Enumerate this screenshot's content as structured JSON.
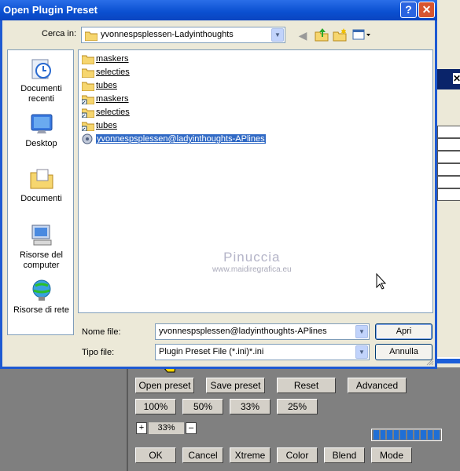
{
  "dialog": {
    "title": "Open Plugin Preset",
    "lookin_label": "Cerca in:",
    "lookin_value": "yvonnespsplessen-Ladyinthoughts",
    "places": [
      {
        "label": "Documenti recenti",
        "icon": "recent-documents-icon"
      },
      {
        "label": "Desktop",
        "icon": "desktop-icon"
      },
      {
        "label": "Documenti",
        "icon": "documents-folder-icon"
      },
      {
        "label": "Risorse del computer",
        "icon": "my-computer-icon"
      },
      {
        "label": "Risorse di rete",
        "icon": "network-icon"
      }
    ],
    "files": [
      {
        "name": "maskers",
        "icon": "folder-icon"
      },
      {
        "name": "selecties",
        "icon": "folder-icon"
      },
      {
        "name": "tubes",
        "icon": "folder-icon"
      },
      {
        "name": "maskers",
        "icon": "folder-shortcut-icon"
      },
      {
        "name": "selecties",
        "icon": "folder-shortcut-icon"
      },
      {
        "name": "tubes",
        "icon": "folder-shortcut-icon"
      },
      {
        "name": "yvonnespsplessen@ladyinthoughts-APlines",
        "icon": "preset-file-icon",
        "selected": true
      }
    ],
    "filename_label": "Nome file:",
    "filename_value": "yvonnespsplessen@ladyinthoughts-APlines",
    "filetype_label": "Tipo file:",
    "filetype_value": "Plugin Preset File (*.ini)*.ini",
    "open_button": "Apri",
    "cancel_button": "Annulla"
  },
  "watermark": {
    "line1": "Pinuccia",
    "line2": "www.maidiregrafica.eu"
  },
  "host_panel": {
    "row1": [
      "Open preset",
      "Save preset",
      "Reset",
      "Advanced"
    ],
    "zoom_buttons": [
      "100%",
      "50%",
      "33%",
      "25%"
    ],
    "stepper": {
      "plus": "+",
      "value": "33%",
      "minus": "–"
    },
    "progress_segments": 10,
    "row3": [
      "OK",
      "Cancel",
      "Xtreme",
      "Color",
      "Blend",
      "Mode"
    ]
  },
  "background": {
    "close_glyph": "✕"
  },
  "colors": {
    "titlebar": "#0a4fd0",
    "selection": "#316ac5",
    "dialog_bg": "#ece9d8"
  }
}
